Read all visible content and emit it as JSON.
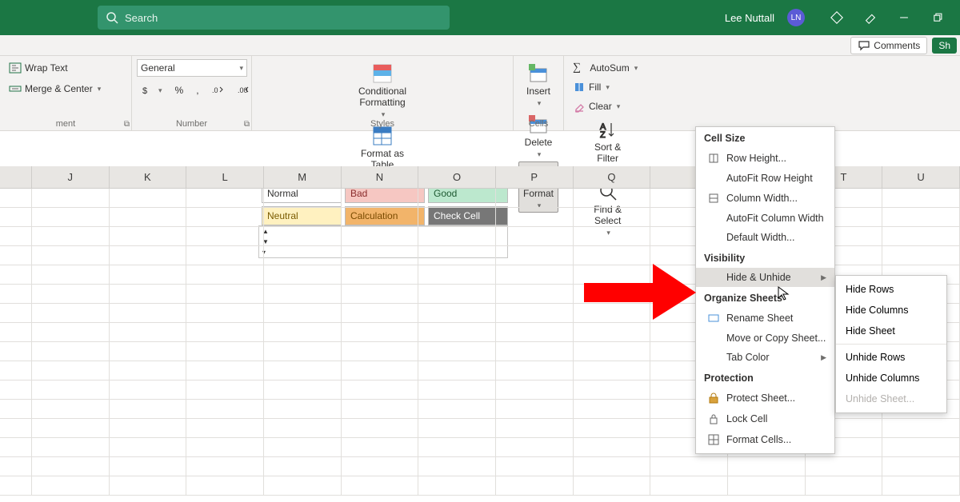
{
  "titlebar": {
    "search_placeholder": "Search",
    "username": "Lee Nuttall",
    "avatar_initials": "LN"
  },
  "commentsrow": {
    "comments_label": "Comments",
    "share_label": "Sh"
  },
  "ribbon": {
    "alignment": {
      "wrap": "Wrap Text",
      "merge": "Merge & Center",
      "group": "ment"
    },
    "number": {
      "format": "General",
      "group": "Number",
      "percent": "%",
      "comma": ",",
      "inc": ".0",
      "dec": ".00"
    },
    "styles": {
      "cond_fmt": "Conditional\nFormatting",
      "fmt_table": "Format as\nTable",
      "group": "Styles",
      "cells": [
        "Normal",
        "Bad",
        "Good",
        "Neutral",
        "Calculation",
        "Check Cell"
      ],
      "colors": [
        "#ffffff",
        "#f6c7c2",
        "#bce8ce",
        "#fff1c0",
        "#f2b46a",
        "#777777"
      ]
    },
    "cells": {
      "insert": "Insert",
      "delete": "Delete",
      "format": "Format",
      "group": "Cells"
    },
    "editing": {
      "autosum": "AutoSum",
      "fill": "Fill",
      "clear": "Clear",
      "sortfilter": "Sort &\nFilter",
      "findselect": "Find &\nSelect"
    }
  },
  "columns": [
    "J",
    "K",
    "L",
    "M",
    "N",
    "O",
    "P",
    "Q",
    "",
    "",
    "T",
    "U"
  ],
  "format_menu": {
    "sec1": "Cell Size",
    "rowheight": "Row Height...",
    "autofitrow": "AutoFit Row Height",
    "colwidth": "Column Width...",
    "autofitcol": "AutoFit Column Width",
    "defwidth": "Default Width...",
    "sec2": "Visibility",
    "hideunhide": "Hide & Unhide",
    "sec3": "Organize Sheets",
    "rename": "Rename Sheet",
    "movecopy": "Move or Copy Sheet...",
    "tabcolor": "Tab Color",
    "sec4": "Protection",
    "protect": "Protect Sheet...",
    "lock": "Lock Cell",
    "fmtcells": "Format Cells..."
  },
  "submenu": {
    "hiderows": "Hide Rows",
    "hidecols": "Hide Columns",
    "hidesheet": "Hide Sheet",
    "unhiderows": "Unhide Rows",
    "unhidecols": "Unhide Columns",
    "unhidesheet": "Unhide Sheet..."
  }
}
